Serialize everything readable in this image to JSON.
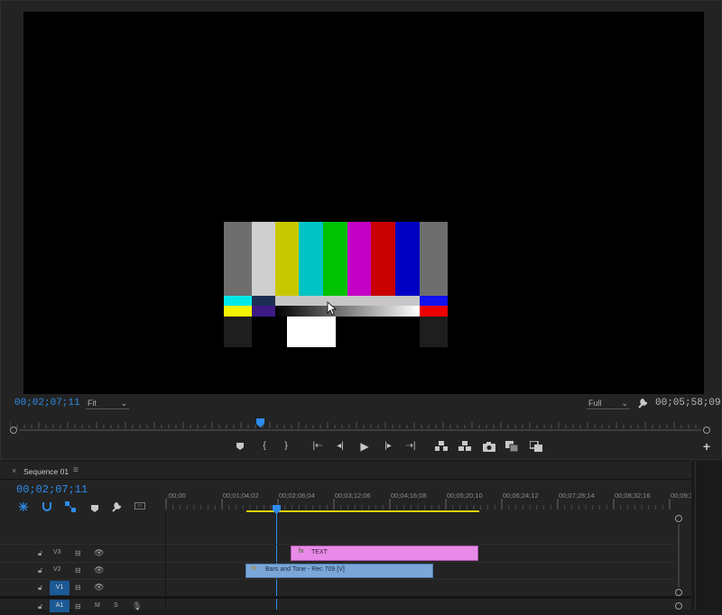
{
  "monitor": {
    "current_timecode": "00;02;07;11",
    "zoom": "Fit",
    "resolution": "Full",
    "duration_timecode": "00;05;58;09",
    "playhead_fraction": 0.36
  },
  "icons": {
    "wrench": "wrench-icon",
    "marker": "marker-icon",
    "mark_in": "mark-in-icon",
    "mark_out": "mark-out-icon",
    "go_to_in": "go-to-in-icon",
    "step_back": "step-back-icon",
    "play": "play-icon",
    "step_forward": "step-forward-icon",
    "go_to_out": "go-to-out-icon",
    "lift": "lift-icon",
    "extract": "extract-icon",
    "export_frame": "camera-icon",
    "compare": "compare-view-icon",
    "overlay": "overlay-icon",
    "add": "add-icon"
  },
  "timeline": {
    "panel_title": "Sequence 01",
    "current_timecode": "00;02;07;11",
    "ruler": [
      ";00;00",
      "00;01;04;02",
      "00;02;08;04",
      "00;03;12;06",
      "00;04;16;08",
      "00;05;20;10",
      "00;06;24;12",
      "00;07;28;14",
      "00;08;32;16",
      "00;09;3"
    ],
    "tracks": [
      {
        "name": "V3"
      },
      {
        "name": "V2"
      },
      {
        "name": "V1"
      },
      {
        "name": "A1",
        "m": "M",
        "s": "S"
      }
    ],
    "clips": {
      "text": "TEXT",
      "bars": "Bars and Tone - Rec 709 [V]"
    }
  },
  "colors": {
    "accent": "#2d8ceb",
    "text_clip": "#e88ae8",
    "bars_clip": "#7aa6d8",
    "work_area": "#e8d400"
  }
}
